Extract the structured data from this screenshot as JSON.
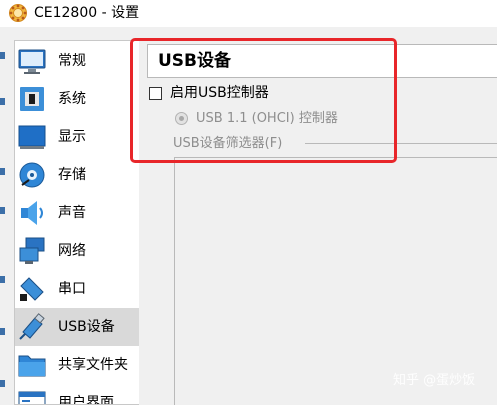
{
  "window": {
    "title": "CE12800 - 设置",
    "icon": "gear-app-icon"
  },
  "sidebar": {
    "items": [
      {
        "label": "常规",
        "icon": "monitor-icon",
        "selected": false
      },
      {
        "label": "系统",
        "icon": "chip-icon",
        "selected": false
      },
      {
        "label": "显示",
        "icon": "display-icon",
        "selected": false
      },
      {
        "label": "存储",
        "icon": "disk-icon",
        "selected": false
      },
      {
        "label": "声音",
        "icon": "speaker-icon",
        "selected": false
      },
      {
        "label": "网络",
        "icon": "network-icon",
        "selected": false
      },
      {
        "label": "串口",
        "icon": "serial-port-icon",
        "selected": false
      },
      {
        "label": "USB设备",
        "icon": "usb-icon",
        "selected": true
      },
      {
        "label": "共享文件夹",
        "icon": "folder-icon",
        "selected": false
      },
      {
        "label": "用户界面",
        "icon": "user-interface-icon",
        "selected": false
      }
    ]
  },
  "main": {
    "section_title": "USB设备",
    "enable_usb_label": "启用USB控制器",
    "enable_usb_checked": false,
    "usb_option_label": "USB 1.1 (OHCI) 控制器",
    "usb_option_selected": true,
    "usb_option_enabled": false,
    "filter_label": "USB设备筛选器(F)"
  },
  "watermark": "知乎 @蛋炒饭",
  "colors": {
    "highlight": "#e8262a",
    "selected_bg": "#d9d9d9",
    "disabled_text": "#8e8e8e",
    "panel_bg": "#f0f0f0"
  }
}
